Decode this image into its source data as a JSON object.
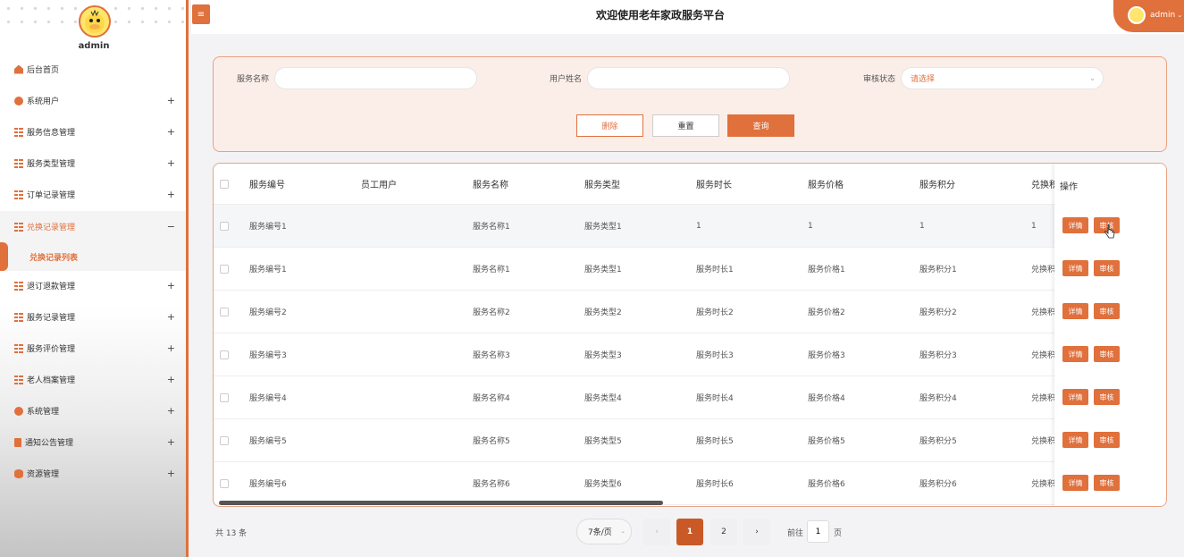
{
  "header": {
    "title": "欢迎使用老年家政服务平台",
    "user": "admin"
  },
  "sidebar": {
    "user": "admin",
    "items": [
      {
        "label": "后台首页",
        "icon": "home-icon",
        "expand": ""
      },
      {
        "label": "系统用户",
        "icon": "user-icon",
        "expand": "+"
      },
      {
        "label": "服务信息管理",
        "icon": "grid-icon",
        "expand": "+"
      },
      {
        "label": "服务类型管理",
        "icon": "grid-icon",
        "expand": "+"
      },
      {
        "label": "订单记录管理",
        "icon": "grid-icon",
        "expand": "+"
      },
      {
        "label": "兑换记录管理",
        "icon": "grid-icon",
        "expand": "−"
      },
      {
        "label": "退订退款管理",
        "icon": "grid-icon",
        "expand": "+"
      },
      {
        "label": "服务记录管理",
        "icon": "grid-icon",
        "expand": "+"
      },
      {
        "label": "服务评价管理",
        "icon": "grid-icon",
        "expand": "+"
      },
      {
        "label": "老人档案管理",
        "icon": "grid-icon",
        "expand": "+"
      },
      {
        "label": "系统管理",
        "icon": "gear-icon",
        "expand": "+"
      },
      {
        "label": "通知公告管理",
        "icon": "doc-icon",
        "expand": "+"
      },
      {
        "label": "资源管理",
        "icon": "database-icon",
        "expand": "+"
      }
    ],
    "submenu_active": "兑换记录列表"
  },
  "search": {
    "service_name_label": "服务名称",
    "service_name_value": "",
    "user_name_label": "用户姓名",
    "user_name_value": "",
    "status_label": "审核状态",
    "status_placeholder": "请选择",
    "delete_label": "删除",
    "reset_label": "重置",
    "query_label": "查询"
  },
  "table": {
    "columns": [
      "服务编号",
      "员工用户",
      "服务名称",
      "服务类型",
      "服务时长",
      "服务价格",
      "服务积分",
      "兑换积"
    ],
    "action_header": "操作",
    "detail_label": "详情",
    "review_label": "审核",
    "rows": [
      [
        "服务编号1",
        "",
        "服务名称1",
        "服务类型1",
        "1",
        "1",
        "1",
        "1"
      ],
      [
        "服务编号1",
        "",
        "服务名称1",
        "服务类型1",
        "服务时长1",
        "服务价格1",
        "服务积分1",
        "兑换积"
      ],
      [
        "服务编号2",
        "",
        "服务名称2",
        "服务类型2",
        "服务时长2",
        "服务价格2",
        "服务积分2",
        "兑换积"
      ],
      [
        "服务编号3",
        "",
        "服务名称3",
        "服务类型3",
        "服务时长3",
        "服务价格3",
        "服务积分3",
        "兑换积"
      ],
      [
        "服务编号4",
        "",
        "服务名称4",
        "服务类型4",
        "服务时长4",
        "服务价格4",
        "服务积分4",
        "兑换积"
      ],
      [
        "服务编号5",
        "",
        "服务名称5",
        "服务类型5",
        "服务时长5",
        "服务价格5",
        "服务积分5",
        "兑换积"
      ],
      [
        "服务编号6",
        "",
        "服务名称6",
        "服务类型6",
        "服务时长6",
        "服务价格6",
        "服务积分6",
        "兑换积"
      ]
    ]
  },
  "pagination": {
    "total": "共 13 条",
    "page_size": "7条/页",
    "prev": "‹",
    "pages": [
      "1",
      "2"
    ],
    "next": "›",
    "goto_prefix": "前往",
    "goto_value": "1",
    "goto_suffix": "页"
  },
  "colors": {
    "accent": "#e0703c",
    "accent_dark": "#c95a27",
    "panel_bg": "#fbeee8"
  }
}
